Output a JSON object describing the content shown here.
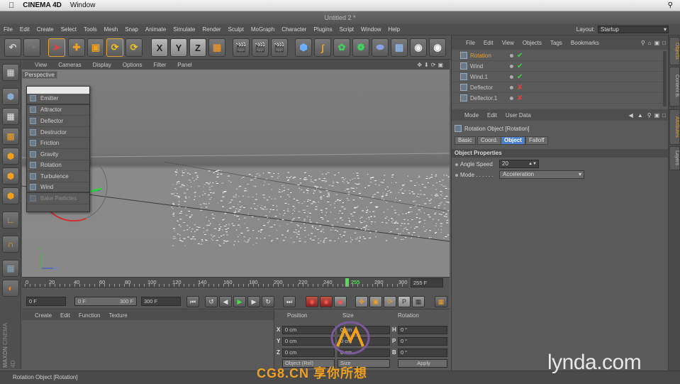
{
  "mac_menu": {
    "app": "CINEMA 4D",
    "window": "Window"
  },
  "window_title": "Untitled 2 *",
  "menu": [
    "File",
    "Edit",
    "Create",
    "Select",
    "Tools",
    "Mesh",
    "Snap",
    "Animate",
    "Simulate",
    "Render",
    "Sculpt",
    "MoGraph",
    "Character",
    "Plugins",
    "Script",
    "Window",
    "Help"
  ],
  "layout": {
    "label": "Layout:",
    "value": "Startup"
  },
  "viewport": {
    "menu": [
      "View",
      "Cameras",
      "Display",
      "Options",
      "Filter",
      "Panel"
    ],
    "camera_label": "Perspective"
  },
  "popup_menu": {
    "items": [
      "Emitter",
      "Attractor",
      "Deflector",
      "Destructor",
      "Friction",
      "Gravity",
      "Rotation",
      "Turbulence",
      "Wind",
      "Bake Particles"
    ]
  },
  "timeline": {
    "ticks": [
      "0",
      "20",
      "40",
      "60",
      "80",
      "100",
      "120",
      "140",
      "160",
      "180",
      "200",
      "220",
      "240",
      "255",
      "280",
      "300"
    ],
    "current_frame_field": "255 F",
    "current_frame": 255
  },
  "transport": {
    "start_field": "0 F",
    "range_start": "0 F",
    "range_end": "300 F",
    "end_field": "300 F"
  },
  "material_menu": [
    "Create",
    "Edit",
    "Function",
    "Texture"
  ],
  "coords": {
    "headers": [
      "Position",
      "Size",
      "Rotation"
    ],
    "rows": [
      {
        "axis": "X",
        "pos": "0 cm",
        "size": "0 cm",
        "rot_axis": "H",
        "rot": "0 °"
      },
      {
        "axis": "Y",
        "pos": "0 cm",
        "size": "0 cm",
        "rot_axis": "P",
        "rot": "0 °"
      },
      {
        "axis": "Z",
        "pos": "0 cm",
        "size": "0 cm",
        "rot_axis": "B",
        "rot": "0 °"
      }
    ],
    "mode": "Object (Rel)",
    "size_mode": "Size",
    "apply": "Apply"
  },
  "status": "Rotation Object [Rotation]",
  "object_manager": {
    "menu": [
      "File",
      "Edit",
      "View",
      "Objects",
      "Tags",
      "Bookmarks"
    ],
    "objects": [
      {
        "name": "Rotation",
        "selected": true,
        "enabled": true
      },
      {
        "name": "Wind",
        "selected": false,
        "enabled": true
      },
      {
        "name": "Wind.1",
        "selected": false,
        "enabled": true
      },
      {
        "name": "Deflector",
        "selected": false,
        "enabled": false
      },
      {
        "name": "Deflector.1",
        "selected": false,
        "enabled": false
      }
    ]
  },
  "attribute_manager": {
    "menu": [
      "Mode",
      "Edit",
      "User Data"
    ],
    "title": "Rotation Object [Rotation]",
    "tabs": [
      "Basic",
      "Coord.",
      "Object",
      "Falloff"
    ],
    "active_tab": "Object",
    "section": "Object Properties",
    "angle_speed_label": "Angle Speed",
    "angle_speed_value": "20",
    "mode_label": "Mode . . . . . .",
    "mode_value": "Acceleration"
  },
  "side_tabs": [
    "Objects",
    "Content B.",
    "Attributes",
    "Layers"
  ],
  "brand": {
    "maxon": "MAXON",
    "cinema": "CINEMA 4D",
    "lynda": "lynda.com",
    "watermark": "CG8.CN 享你所想"
  },
  "colors": {
    "accent_orange": "#e0a030",
    "active_blue": "#4a7fd0",
    "green_enabled": "#3ad83a",
    "red_disabled": "#e04040"
  }
}
